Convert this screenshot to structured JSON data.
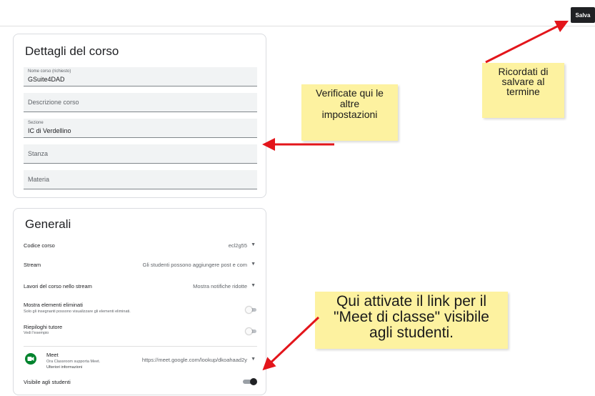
{
  "toolbar": {
    "save_label": "Salva"
  },
  "details": {
    "title": "Dettagli del corso",
    "course_name": {
      "label": "Nome corso (richiesto)",
      "value": "GSuite4DAD"
    },
    "description": {
      "placeholder": "Descrizione corso"
    },
    "section": {
      "label": "Sezione",
      "value": "IC di Verdellino"
    },
    "room": {
      "placeholder": "Stanza"
    },
    "subject": {
      "placeholder": "Materia"
    }
  },
  "general": {
    "title": "Generali",
    "course_code": {
      "label": "Codice corso",
      "value": "ecl2g55"
    },
    "stream": {
      "label": "Stream",
      "value": "Gli studenti possono aggiungere post e com"
    },
    "classwork": {
      "label": "Lavori del corso nello stream",
      "value": "Mostra notifiche ridotte"
    },
    "deleted_items": {
      "label": "Mostra elementi eliminati",
      "sub": "Solo gli insegnanti possono visualizzare gli elementi eliminati.",
      "enabled": false
    },
    "guardian_summaries": {
      "label": "Riepiloghi tutore",
      "sub": "Vedi l'esempio",
      "enabled": false
    },
    "meet": {
      "label": "Meet",
      "sub1": "Ora Classroom supporta Meet.",
      "sub2": "Ulteriori informazioni",
      "link": "https://meet.google.com/lookup/dkoahaad2y",
      "visible_label": "Visibile agli studenti",
      "visible": true
    }
  },
  "notes": {
    "settings": [
      "Verificate qui le",
      "altre",
      "impostazioni"
    ],
    "save": [
      "Ricordati di",
      "salvare al",
      "termine"
    ],
    "meet": [
      "Qui attivate il link per il",
      "\"Meet di classe\" visibile",
      "agli studenti."
    ]
  },
  "colors": {
    "note": "#fdf2a0",
    "arrow": "#e3151b",
    "meet_green": "#00832d"
  }
}
